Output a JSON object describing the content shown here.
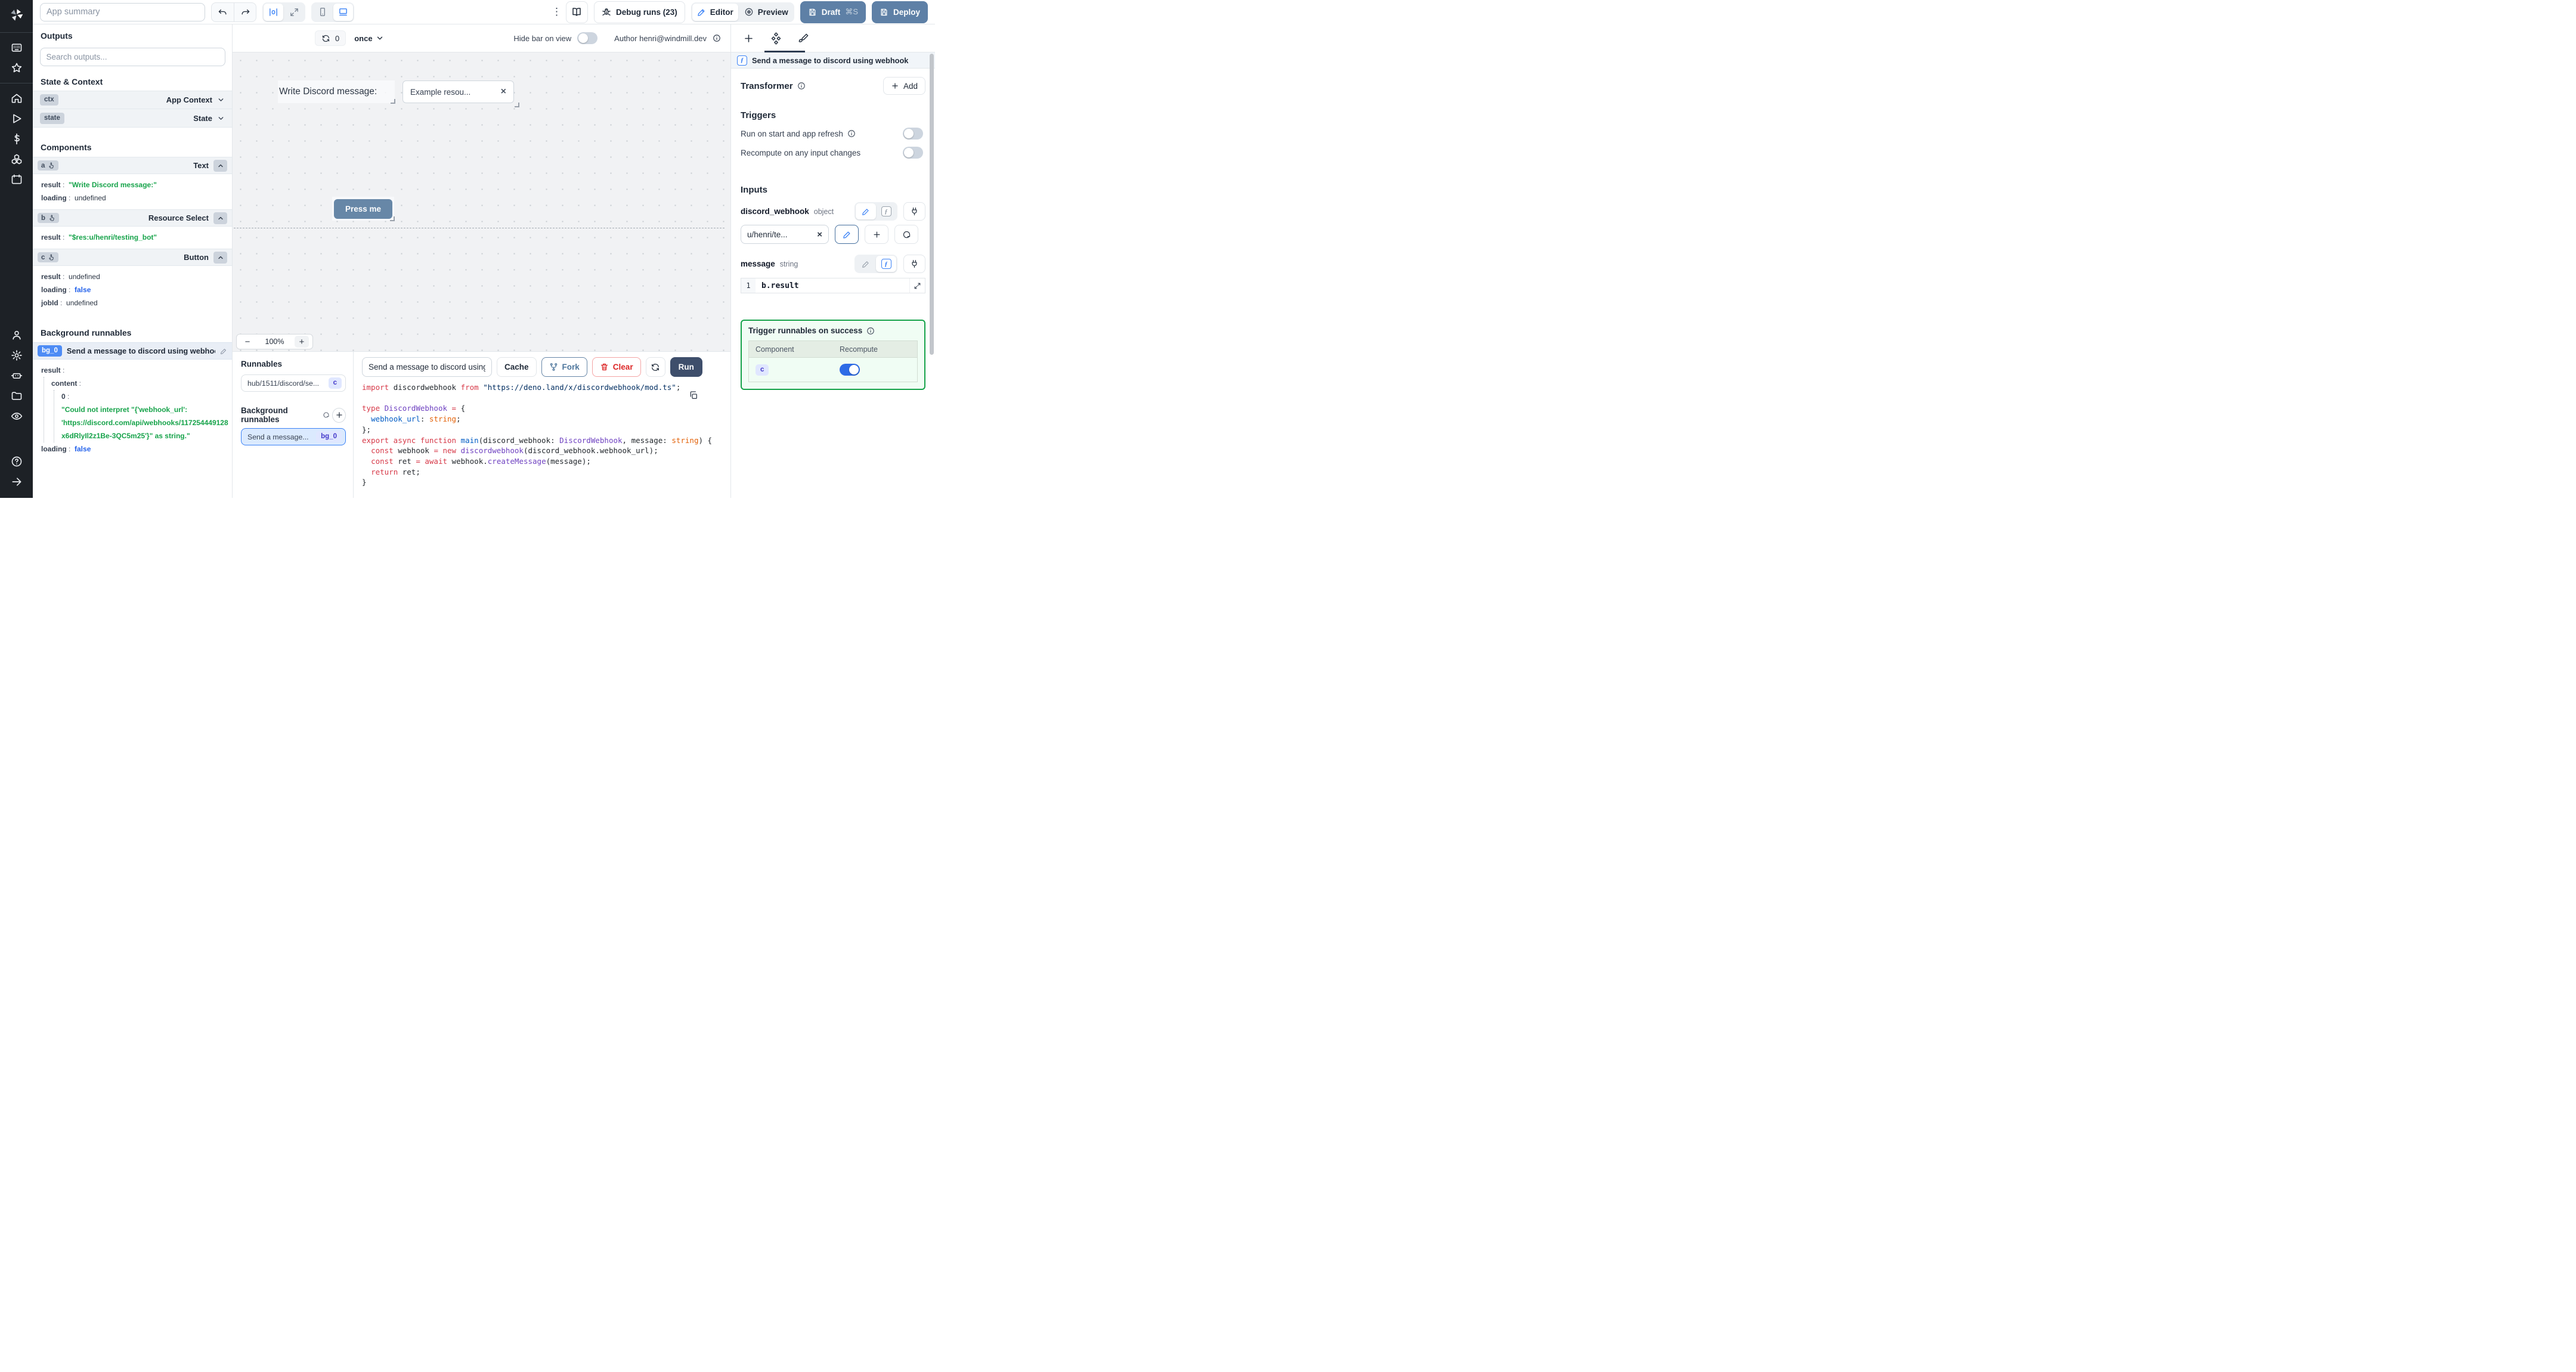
{
  "topbar": {
    "app_summary_placeholder": "App summary",
    "debug_runs_label": "Debug runs (23)",
    "editor_label": "Editor",
    "preview_label": "Preview",
    "draft_label": "Draft",
    "draft_shortcut": "⌘S",
    "deploy_label": "Deploy"
  },
  "sidebar": {
    "icons": [
      "windmill-logo",
      "apps",
      "favorites",
      "home",
      "runs",
      "variables",
      "resources",
      "schedules",
      "users",
      "settings",
      "workers",
      "folders",
      "audit-logs",
      "help",
      "collapse"
    ]
  },
  "outputs": {
    "title": "Outputs",
    "search_placeholder": "Search outputs...",
    "state_context_title": "State & Context",
    "ctx": {
      "id": "ctx",
      "type": "App Context"
    },
    "state": {
      "id": "state",
      "type": "State"
    },
    "components_title": "Components",
    "a": {
      "id": "a",
      "type": "Text",
      "result_key": "result",
      "result": "\"Write Discord message:\"",
      "loading_key": "loading",
      "loading": "undefined"
    },
    "b": {
      "id": "b",
      "type": "Resource Select",
      "result_key": "result",
      "result": "\"$res:u/henri/testing_bot\""
    },
    "c": {
      "id": "c",
      "type": "Button",
      "result_key": "result",
      "result": "undefined",
      "loading_key": "loading",
      "loading": "false",
      "jobid_key": "jobId",
      "jobid": "undefined"
    },
    "background_title": "Background runnables",
    "bg": {
      "id": "bg_0",
      "name": "Send a message to discord using webhook",
      "result_key": "result",
      "content_key": "content",
      "index_key": "0",
      "error_line1": "\"Could not interpret \"{'webhook_url':",
      "error_line2": "'https://discord.com/api/webhooks/117254449128",
      "error_line3": "x6dRlyIl2z1Be-3QC5m25'}\" as string.\"",
      "loading_key": "loading",
      "loading": "false"
    }
  },
  "center": {
    "runs_count": "0",
    "mode": "once",
    "hide_bar_label": "Hide bar on view",
    "author_label": "Author henri@windmill.dev",
    "canvas": {
      "text_component": "Write Discord message:",
      "select_value": "Example resou...",
      "select_clear": "×",
      "button_label": "Press me"
    },
    "zoom": {
      "minus": "−",
      "level": "100%",
      "plus": "+"
    }
  },
  "runnables": {
    "title": "Runnables",
    "item": {
      "path": "hub/1511/discord/se...",
      "badge": "c"
    },
    "background_title": "Background runnables",
    "bg_item": {
      "name": "Send a message...",
      "badge": "bg_0"
    }
  },
  "editor": {
    "name_value": "Send a message to discord using",
    "cache_label": "Cache",
    "fork_label": "Fork",
    "clear_label": "Clear",
    "run_label": "Run",
    "code_lines": [
      [
        [
          "k",
          "import "
        ],
        [
          "p",
          "discordwebhook "
        ],
        [
          "k",
          "from "
        ],
        [
          "s",
          "\"https://deno.land/x/discordwebhook/mod.ts\""
        ],
        [
          "p",
          ";"
        ]
      ],
      [],
      [
        [
          "k",
          "type "
        ],
        [
          "t",
          "DiscordWebhook "
        ],
        [
          "k",
          "= "
        ],
        [
          "p",
          "{"
        ]
      ],
      [
        [
          "p",
          "  "
        ],
        [
          "b",
          "webhook_url"
        ],
        [
          "p",
          ": "
        ],
        [
          "o",
          "string"
        ],
        [
          "p",
          ";"
        ]
      ],
      [
        [
          "p",
          "};"
        ]
      ],
      [
        [
          "k",
          "export async function "
        ],
        [
          "f",
          "main"
        ],
        [
          "p",
          "(discord_webhook: "
        ],
        [
          "t",
          "DiscordWebhook"
        ],
        [
          "p",
          ", message: "
        ],
        [
          "o",
          "string"
        ],
        [
          "p",
          ") {"
        ]
      ],
      [
        [
          "p",
          "  "
        ],
        [
          "k",
          "const "
        ],
        [
          "p",
          "webhook "
        ],
        [
          "k",
          "= new "
        ],
        [
          "t",
          "discordwebhook"
        ],
        [
          "p",
          "(discord_webhook.webhook_url);"
        ]
      ],
      [
        [
          "p",
          "  "
        ],
        [
          "k",
          "const "
        ],
        [
          "p",
          "ret "
        ],
        [
          "k",
          "= await "
        ],
        [
          "p",
          "webhook."
        ],
        [
          "t",
          "createMessage"
        ],
        [
          "p",
          "(message);"
        ]
      ],
      [
        [
          "p",
          "  "
        ],
        [
          "k",
          "return "
        ],
        [
          "p",
          "ret;"
        ]
      ],
      [
        [
          "p",
          "}"
        ]
      ]
    ]
  },
  "right": {
    "header": "Send a message to discord using webhook",
    "transformer_title": "Transformer",
    "add_label": "Add",
    "triggers_title": "Triggers",
    "trigger_rows": [
      {
        "label": "Run on start and app refresh",
        "on": false
      },
      {
        "label": "Recompute on any input changes",
        "on": false
      }
    ],
    "inputs_title": "Inputs",
    "discord_webhook": {
      "name": "discord_webhook",
      "type": "object",
      "value": "u/henri/te...",
      "clear": "×"
    },
    "message": {
      "name": "message",
      "type": "string",
      "line_number": "1",
      "expr": "b.result"
    },
    "success": {
      "title": "Trigger runnables on success",
      "col_component": "Component",
      "col_recompute": "Recompute",
      "row_badge": "c",
      "recompute_on": true
    }
  },
  "colors": {
    "accent": "#3b82f6",
    "slate_button": "#5e80a6",
    "canvas_button": "#6787a7",
    "run_button": "#3e4e6b",
    "result_green": "#16a34a",
    "value_blue": "#2563eb",
    "toggle_on": "#2e6be6",
    "success_border": "#16a34a",
    "bg_badge_blue": "#4e8cf5",
    "indigo_badge_bg": "#e0e7ff",
    "indigo_badge_text": "#4338ca"
  }
}
